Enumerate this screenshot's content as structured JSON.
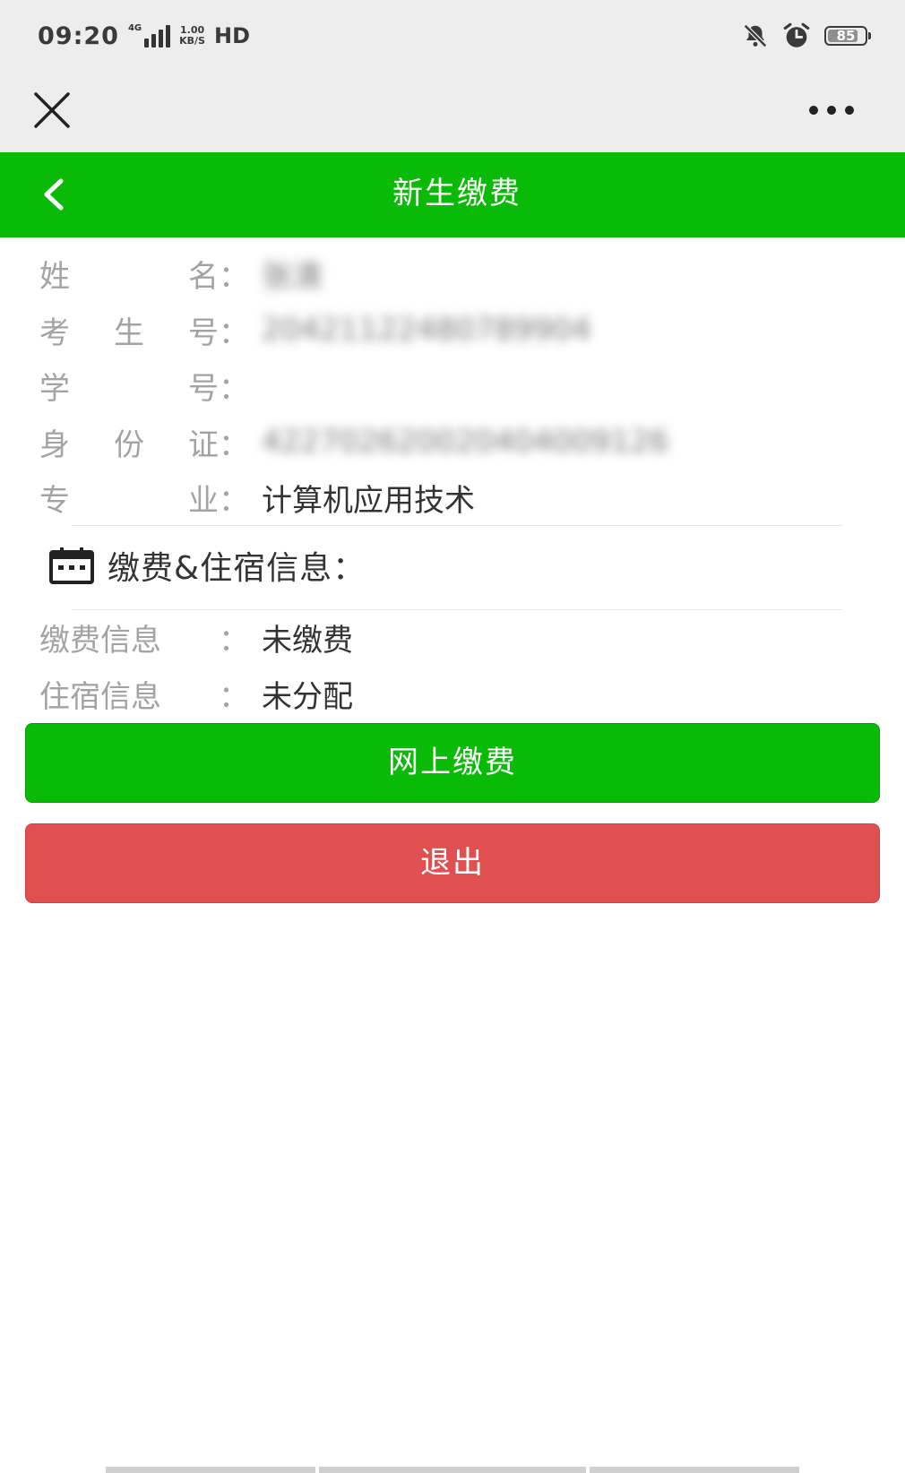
{
  "status_bar": {
    "time": "09:20",
    "network_type": "4G",
    "speed_value": "1.00",
    "speed_unit": "KB/S",
    "hd_label": "HD",
    "battery_level": 85,
    "battery_text": "85",
    "icons": [
      "signal-icon",
      "bell-off-icon",
      "alarm-icon",
      "battery-icon"
    ]
  },
  "wechat_nav": {
    "close_icon": "close-icon",
    "more_icon": "more-icon"
  },
  "header": {
    "title": "新生缴费",
    "back_icon": "chevron-left-icon",
    "color": "#09bb07"
  },
  "student": {
    "name": {
      "label": [
        "姓",
        "名"
      ],
      "colon": "：",
      "value": "张清"
    },
    "exam_no": {
      "label": [
        "考",
        "生",
        "号"
      ],
      "colon": "：",
      "value": "20421122480789904"
    },
    "student_no": {
      "label": [
        "学",
        "号"
      ],
      "colon": "：",
      "value": ""
    },
    "id_card": {
      "label": [
        "身",
        "份",
        "证"
      ],
      "colon": "：",
      "value": "422702620020404009126"
    },
    "major": {
      "label": [
        "专",
        "业"
      ],
      "colon": "：",
      "value": "计算机应用技术"
    }
  },
  "section": {
    "title": "缴费&住宿信息：",
    "icon": "calendar-icon"
  },
  "status": {
    "payment": {
      "label": "缴费信息",
      "colon": "：",
      "value": "未缴费"
    },
    "dorm": {
      "label": "住宿信息",
      "colon": "：",
      "value": "未分配"
    }
  },
  "buttons": {
    "pay_label": "网上缴费",
    "exit_label": "退出",
    "pay_color": "#09bb07",
    "exit_color": "#e05050"
  }
}
